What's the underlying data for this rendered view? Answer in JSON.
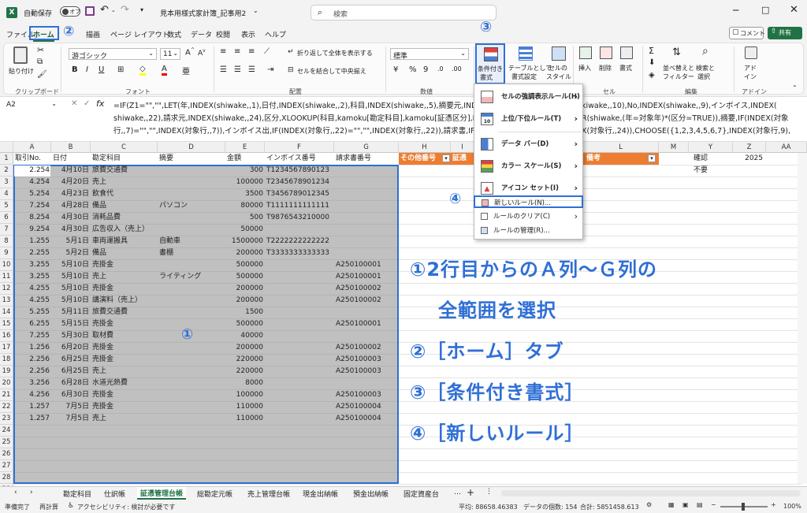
{
  "titlebar": {
    "autosave": "自動保存",
    "autosave_state": "オフ",
    "title": "見本用様式家計簿_記事用2",
    "search": "検索"
  },
  "menu": {
    "items": [
      "ファイル",
      "ホーム",
      "挿入",
      "描画",
      "ページ レイアウト",
      "数式",
      "データ",
      "校閲",
      "表示",
      "ヘルプ"
    ],
    "comment": "コメント",
    "share": "共有"
  },
  "ribbon": {
    "paste": "貼り付け",
    "clipboard": "クリップボード",
    "font_name": "游ゴシック",
    "font_size": "11",
    "font_group": "フォント",
    "wrap": "折り返して全体を表示する",
    "merge": "セルを結合して中央揃え",
    "align_group": "配置",
    "number_format": "標準",
    "number_group": "数値",
    "cond_format": [
      "条件付き",
      "書式"
    ],
    "table_format": [
      "テーブルとして",
      "書式設定"
    ],
    "cell_style": [
      "セルの",
      "スタイル"
    ],
    "insert": "挿入",
    "delete": "削除",
    "format": "書式",
    "cells_group": "セル",
    "sort": [
      "並べ替えと",
      "フィルター"
    ],
    "find": [
      "検索と",
      "選択"
    ],
    "edit_group": "編集",
    "addin": [
      "アド",
      "イン"
    ],
    "addin_group": "アドイン"
  },
  "namebox": "A2",
  "formula": [
    "=IF(Z1=\"\",\"\",LET(年,INDEX(shiwake,,1),日付,INDEX(shiwake,,2),科目,INDEX(shiwake,,5),摘要元,INDE",
    "shiwake,,22),請求元,INDEX(shiwake,,24),区分,XLOOKUP(科目,kamoku[勘定科目],kamoku[証憑区分],F",
    "行,,7)=\"\",\"\",INDEX(対象行,,7)),インボイス出,IF(INDEX(対象行,,22)=\"\",\"\",INDEX(対象行,,22)),請求書,IF("
  ],
  "formula_right": [
    "kiwake,,10),No,INDEX(shiwake,,9),インボイス,INDEX(",
    "R(shiwake,(年=対象年)*(区分=TRUE)),摘要,IF(INDEX(対象",
    "X(対象行,,24)),CHOOSE({1,2,3,4,5,6,7},INDEX(対象行,9),"
  ],
  "columns": [
    "A",
    "B",
    "C",
    "D",
    "E",
    "F",
    "G",
    "H",
    "I",
    "L",
    "M",
    "Y",
    "Z",
    "AA"
  ],
  "header_row": [
    "取引No.",
    "日付",
    "勘定科目",
    "摘要",
    "金額",
    "インボイス番号",
    "請求書番号"
  ],
  "header_orange": [
    "その他番号",
    "証憑",
    "備考"
  ],
  "row1_extra": {
    "y": "確認",
    "z": "2025"
  },
  "row2_extra": {
    "y": "不要"
  },
  "rows": [
    [
      "2.254",
      "4月10日",
      "旅費交通費",
      "",
      "300",
      "T1234567890123",
      ""
    ],
    [
      "4.254",
      "4月20日",
      "売上",
      "",
      "100000",
      "T2345678901234",
      ""
    ],
    [
      "5.254",
      "4月23日",
      "飲食代",
      "",
      "3500",
      "T3456789012345",
      ""
    ],
    [
      "7.254",
      "4月28日",
      "備品",
      "パソコン",
      "80000",
      "T1111111111111",
      ""
    ],
    [
      "8.254",
      "4月30日",
      "消耗品費",
      "",
      "500",
      "T9876543210000",
      ""
    ],
    [
      "9.254",
      "4月30日",
      "広告収入（売上）",
      "",
      "50000",
      "",
      ""
    ],
    [
      "1.255",
      "5月1日",
      "車両運搬具",
      "自動車",
      "1500000",
      "T2222222222222",
      ""
    ],
    [
      "2.255",
      "5月2日",
      "備品",
      "書棚",
      "200000",
      "T3333333333333",
      ""
    ],
    [
      "3.255",
      "5月10日",
      "売掛金",
      "",
      "500000",
      "",
      "A250100001"
    ],
    [
      "3.255",
      "5月10日",
      "売上",
      "ライティング",
      "500000",
      "",
      "A250100001"
    ],
    [
      "4.255",
      "5月10日",
      "売掛金",
      "",
      "200000",
      "",
      "A250100002"
    ],
    [
      "4.255",
      "5月10日",
      "講演料（売上）",
      "",
      "200000",
      "",
      "A250100002"
    ],
    [
      "5.255",
      "5月11日",
      "旅費交通費",
      "",
      "1500",
      "",
      ""
    ],
    [
      "6.255",
      "5月15日",
      "売掛金",
      "",
      "500000",
      "",
      "A250100001"
    ],
    [
      "7.255",
      "5月30日",
      "取材費",
      "",
      "40000",
      "",
      ""
    ],
    [
      "1.256",
      "6月20日",
      "売掛金",
      "",
      "200000",
      "",
      "A250100002"
    ],
    [
      "2.256",
      "6月25日",
      "売掛金",
      "",
      "220000",
      "",
      "A250100003"
    ],
    [
      "2.256",
      "6月25日",
      "売上",
      "",
      "220000",
      "",
      "A250100003"
    ],
    [
      "3.256",
      "6月28日",
      "水道光熱費",
      "",
      "8000",
      "",
      ""
    ],
    [
      "4.256",
      "6月30日",
      "売掛金",
      "",
      "100000",
      "",
      "A250100003"
    ],
    [
      "1.257",
      "7月5日",
      "売掛金",
      "",
      "110000",
      "",
      "A250100004"
    ],
    [
      "1.257",
      "7月5日",
      "売上",
      "",
      "110000",
      "",
      "A250100004"
    ]
  ],
  "row_numbers": [
    "1",
    "2",
    "3",
    "4",
    "5",
    "6",
    "7",
    "8",
    "9",
    "10",
    "11",
    "12",
    "13",
    "14",
    "15",
    "16",
    "17",
    "18",
    "19",
    "20",
    "21",
    "22",
    "23",
    "24",
    "25",
    "26",
    "27",
    "28",
    "29",
    "30",
    "31"
  ],
  "menu_cf": [
    {
      "label": "セルの強調表示ルール(H)",
      "arrow": "›"
    },
    {
      "label": "上位/下位ルール(T)",
      "arrow": "›"
    },
    {
      "label": "データ バー(D)",
      "arrow": "›"
    },
    {
      "label": "カラー スケール(S)",
      "arrow": "›"
    },
    {
      "label": "アイコン セット(I)",
      "arrow": "›"
    },
    {
      "label": "新しいルール(N)..."
    },
    {
      "label": "ルールのクリア(C)",
      "arrow": "›"
    },
    {
      "label": "ルールの管理(R)..."
    }
  ],
  "annotations": {
    "n1": "①",
    "n2": "②",
    "n3": "③",
    "n4": "④",
    "area": "①"
  },
  "instructions": [
    "①2行目からのＡ列～Ｇ列の",
    "全範囲を選択",
    "②［ホーム］タブ",
    "③［条件付き書式］",
    "④［新しいルール］"
  ],
  "sheet_tabs": [
    "勘定科目",
    "仕訳帳",
    "証憑管理台帳",
    "総勘定元帳",
    "売上管理台帳",
    "現金出納帳",
    "預金出納帳",
    "固定資産台"
  ],
  "active_tab": "証憑管理台帳",
  "status": {
    "ready": "準備完了",
    "recalc": "再計算",
    "access": "アクセシビリティ: 検討が必要です",
    "avg": "平均: 88658.46383",
    "count": "データの個数: 154",
    "sum": "合計: 5851458.613",
    "zoom": "100%"
  },
  "colors": {
    "accent": "#2f6fd6",
    "orange": "#ed7d31",
    "green": "#217346"
  }
}
